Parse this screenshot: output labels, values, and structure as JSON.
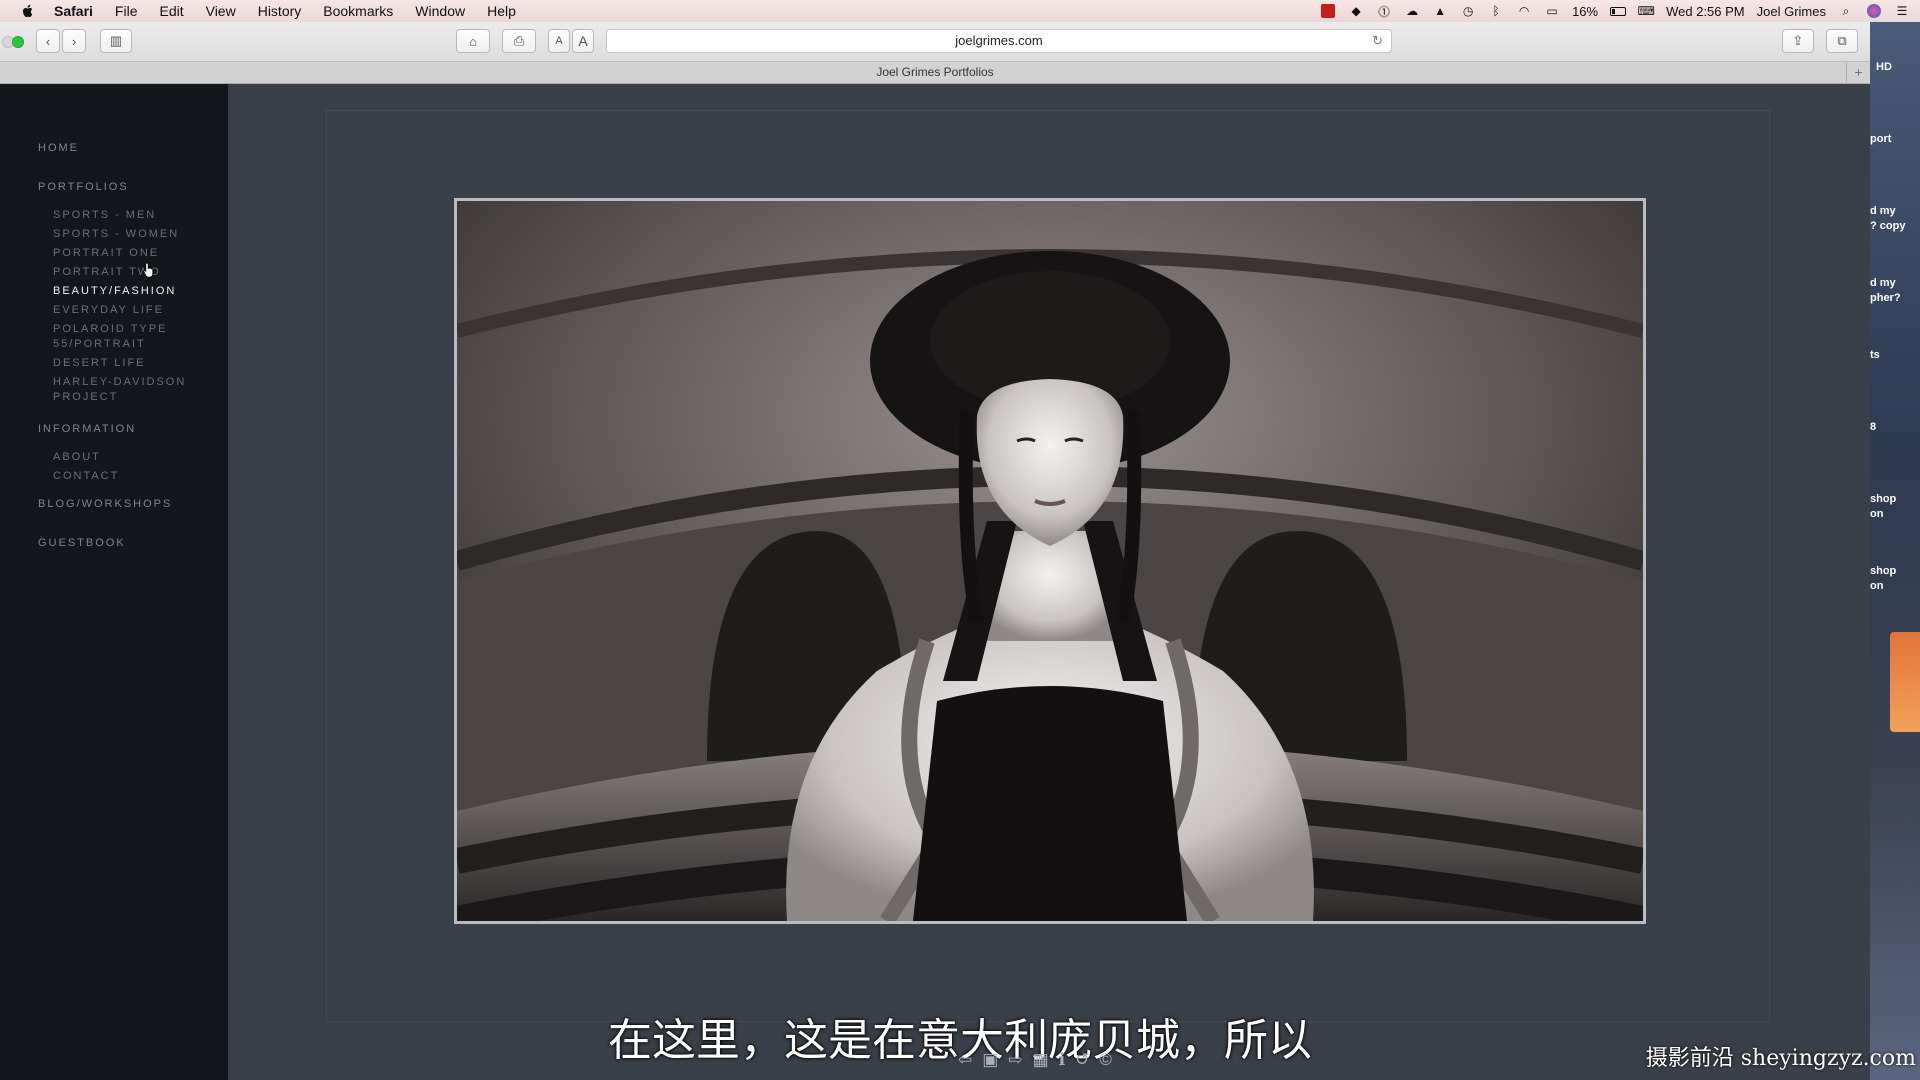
{
  "menubar": {
    "app": "Safari",
    "items": [
      "File",
      "Edit",
      "View",
      "History",
      "Bookmarks",
      "Window",
      "Help"
    ],
    "battery": "16%",
    "clock": "Wed 2:56 PM",
    "user": "Joel Grimes"
  },
  "toolbar": {
    "url": "joelgrimes.com",
    "font_small": "A",
    "font_large": "A"
  },
  "tab": {
    "title": "Joel Grimes Portfolios"
  },
  "desktop": {
    "labels": [
      "HD",
      "port",
      "d my\n? copy",
      "d my\npher?",
      "ts",
      "8",
      "shop\non",
      "shop\non"
    ]
  },
  "site": {
    "nav": {
      "home": "HOME",
      "portfolios": "PORTFOLIOS",
      "portfolio_items": [
        "SPORTS - MEN",
        "SPORTS - WOMEN",
        "PORTRAIT ONE",
        "PORTRAIT TWO",
        "BEAUTY/FASHION",
        "EVERYDAY LIFE",
        "POLAROID TYPE 55/PORTRAIT",
        "DESERT LIFE",
        "HARLEY-DAVIDSON PROJECT"
      ],
      "active_item": "BEAUTY/FASHION",
      "information": "INFORMATION",
      "info_items": [
        "ABOUT",
        "CONTACT"
      ],
      "blog": "BLOG/WORKSHOPS",
      "guestbook": "GUESTBOOK"
    },
    "viewer": {
      "controls": [
        "prev-arrow-icon",
        "gallery-icon",
        "next-arrow-icon",
        "grid-icon",
        "info-icon",
        "loop-icon",
        "copyright-icon"
      ]
    }
  },
  "overlay": {
    "subtitle": "在这里，这是在意大利庞贝城，所以",
    "watermark": "摄影前沿 sheyingzyz.com"
  }
}
